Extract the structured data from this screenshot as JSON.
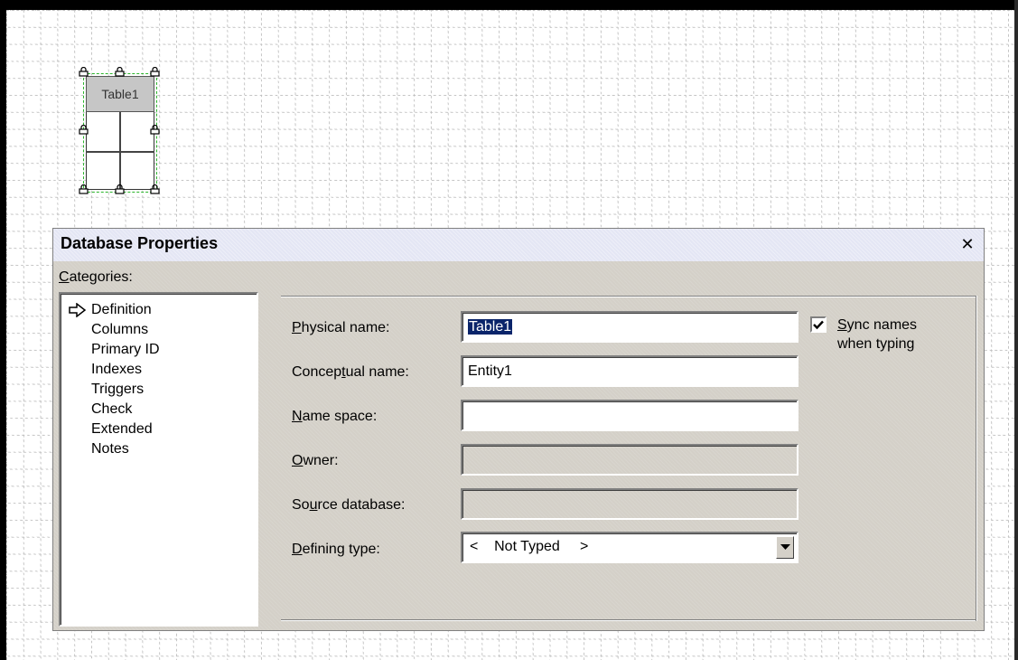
{
  "canvas": {
    "table_shape": {
      "label": "Table1"
    }
  },
  "dialog": {
    "title": "Database Properties",
    "close_glyph": "✕",
    "categories_label_u": "C",
    "categories_label_rest": "ategories:",
    "categories": [
      {
        "label": "Definition",
        "selected": true
      },
      {
        "label": "Columns"
      },
      {
        "label": "Primary ID"
      },
      {
        "label": "Indexes"
      },
      {
        "label": "Triggers"
      },
      {
        "label": "Check"
      },
      {
        "label": "Extended"
      },
      {
        "label": "Notes"
      }
    ],
    "fields": {
      "physical_name": {
        "label_u": "P",
        "label_rest": "hysical name:",
        "value": "Table1"
      },
      "conceptual_name": {
        "label_pre": "Concep",
        "label_u": "t",
        "label_rest": "ual name:",
        "value": "Entity1"
      },
      "name_space": {
        "label_u": "N",
        "label_rest": "ame space:",
        "value": ""
      },
      "owner": {
        "label_u": "O",
        "label_rest": "wner:",
        "value": ""
      },
      "source_database": {
        "label_pre": "So",
        "label_u": "u",
        "label_rest": "rce database:",
        "value": ""
      },
      "defining_type": {
        "label_u": "D",
        "label_rest": "efining type:",
        "value": "<    Not Typed     >"
      }
    },
    "sync_names": {
      "checked": true,
      "label_u": "S",
      "label_rest": "ync names",
      "label_line2": "when typing"
    }
  },
  "icons": {
    "selection_handles": "lock-handle-icon",
    "category_pointer": "arrow-right-icon",
    "dropdown": "chevron-down-icon",
    "checkmark": "checkmark-icon"
  },
  "colors": {
    "dialog_bg": "#d4d0c8",
    "titlebar_bg": "#e4e6f4",
    "selection_highlight": "#0a246a",
    "selection_border": "#2bb52b"
  }
}
